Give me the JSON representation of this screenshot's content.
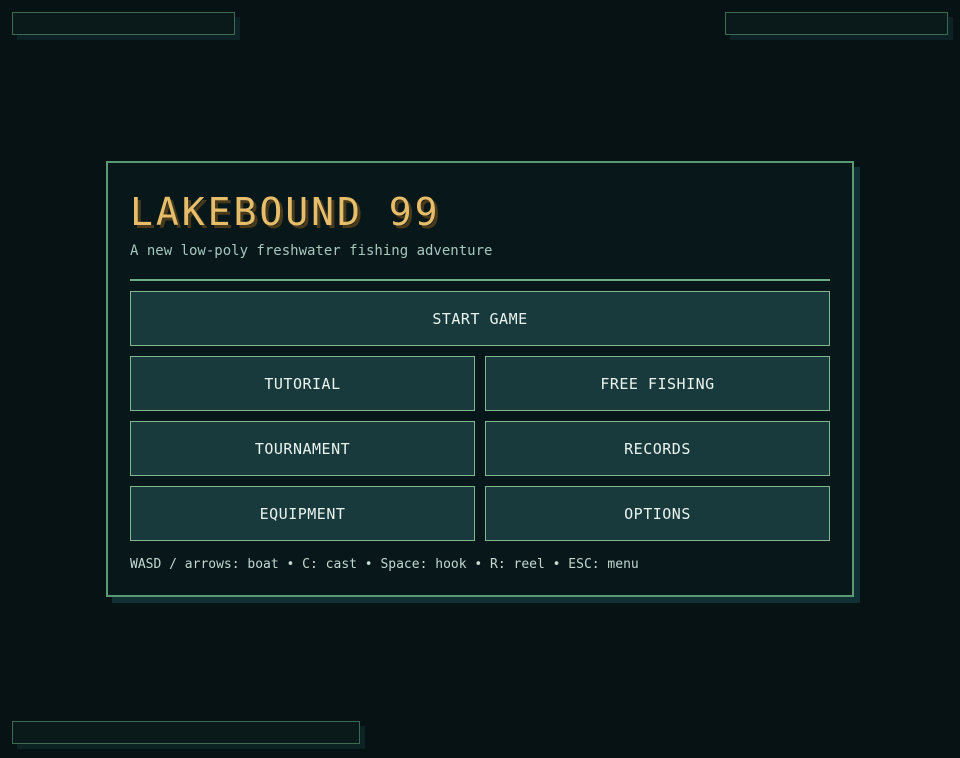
{
  "game": {
    "title": "LAKEBOUND 99",
    "subtitle": "A new low-poly freshwater fishing adventure"
  },
  "menu": {
    "start": "START GAME",
    "tutorial": "TUTORIAL",
    "free_fishing": "FREE FISHING",
    "tournament": "TOURNAMENT",
    "records": "RECORDS",
    "equipment": "EQUIPMENT",
    "options": "OPTIONS"
  },
  "controls_hint": "WASD / arrows: boat • C: cast • Space: hook • R: reel • ESC: menu",
  "colors": {
    "background": "#061214",
    "panel": "#081719",
    "border": "#5a9a72",
    "button": "#193a3d",
    "title": "#e6bd6a"
  }
}
